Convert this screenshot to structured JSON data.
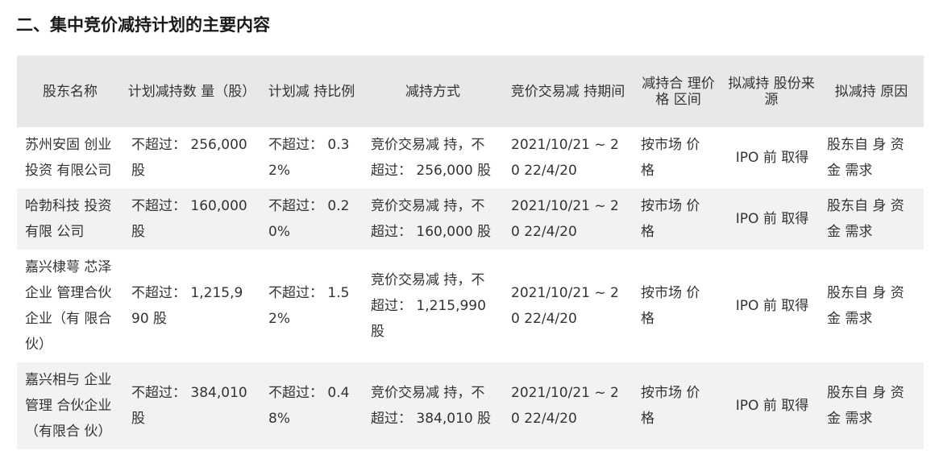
{
  "section": {
    "title": "二、集中竞价减持计划的主要内容"
  },
  "table": {
    "headers": [
      "股东名称",
      "计划减持数 量（股）",
      "计划减 持比例",
      "减持方式",
      "竞价交易减 持期间",
      "减持合 理价格 区间",
      "拟减持 股份来 源",
      "拟减持 原因"
    ],
    "rows": [
      {
        "name": "苏州安固 创业 投资 有限公司",
        "quantity": "不超过： 256,000 股",
        "ratio": "不超过： 0.3 2%",
        "method": "竞价交易减 持，不 超过： 256,000 股",
        "period": "2021/10/21 ~ 20 22/4/20",
        "price": "按市场 价 格",
        "source": "IPO 前 取得",
        "reason": "股东自 身 资金 需求"
      },
      {
        "name": "哈勃科技 投资 有限 公司",
        "quantity": "不超过： 160,000 股",
        "ratio": "不超过： 0.2 0%",
        "method": "竞价交易减 持，不 超过： 160,000 股",
        "period": "2021/10/21 ~ 20 22/4/20",
        "price": "按市场 价 格",
        "source": "IPO 前 取得",
        "reason": "股东自 身 资金 需求"
      },
      {
        "name": "嘉兴棣萼 芯泽 企业 管理合伙 企业（有 限合 伙）",
        "quantity": "不超过： 1,215,9 90 股",
        "ratio": "不超过： 1.5 2%",
        "method": "竞价交易减 持，不 超过： 1,215,990 股",
        "period": "2021/10/21 ~ 20 22/4/20",
        "price": "按市场 价 格",
        "source": "IPO 前 取得",
        "reason": "股东自 身 资金 需求"
      },
      {
        "name": "嘉兴相与 企业 管理 合伙企业 （有限合 伙）",
        "quantity": "不超过： 384,010 股",
        "ratio": "不超过： 0.4 8%",
        "method": "竞价交易减 持，不 超过： 384,010 股",
        "period": "2021/10/21 ~ 20 22/4/20",
        "price": "按市场 价 格",
        "source": "IPO 前 取得",
        "reason": "股东自 身 资金 需求"
      }
    ]
  }
}
